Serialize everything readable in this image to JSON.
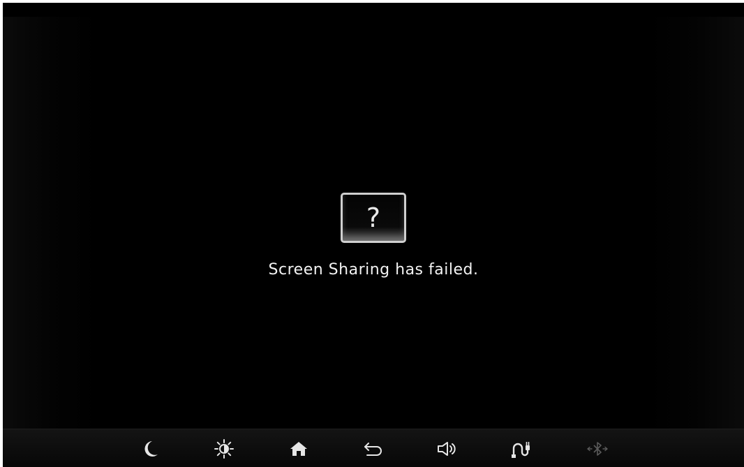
{
  "error": {
    "icon_glyph": "?",
    "message": "Screen Sharing has failed."
  },
  "bottom_bar": {
    "buttons": [
      {
        "name": "night-mode-button",
        "icon": "crescent-moon-icon"
      },
      {
        "name": "brightness-button",
        "icon": "sun-brightness-icon"
      },
      {
        "name": "home-button",
        "icon": "home-icon"
      },
      {
        "name": "back-button",
        "icon": "back-arrow-icon"
      },
      {
        "name": "volume-button",
        "icon": "speaker-icon"
      },
      {
        "name": "audio-source-button",
        "icon": "cable-plug-icon"
      },
      {
        "name": "bluetooth-button",
        "icon": "bluetooth-icon",
        "disabled": true
      }
    ]
  },
  "colors": {
    "background": "#000000",
    "text": "#f2f2f2",
    "icon": "#e6e6e6",
    "icon_disabled": "#5a5a5a",
    "frame": "#cfcfcf"
  }
}
